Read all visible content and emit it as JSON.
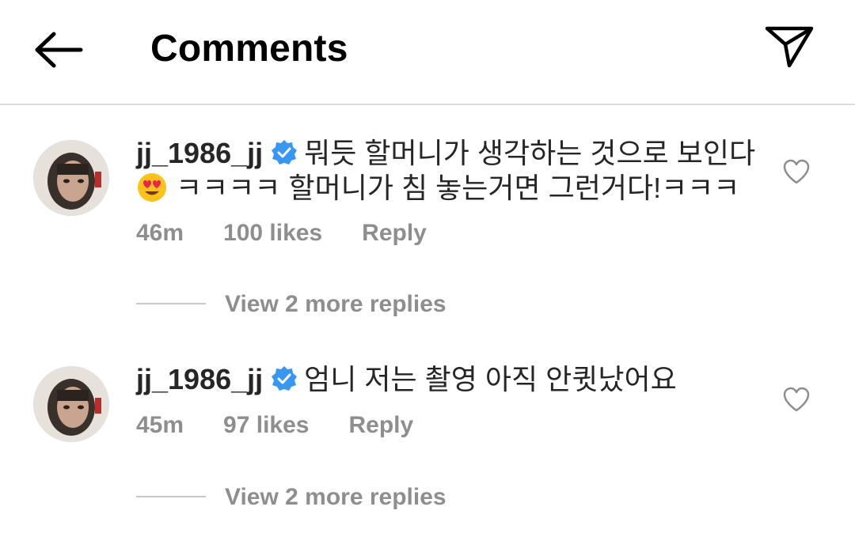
{
  "header": {
    "title": "Comments",
    "back_icon": "arrow-left-icon",
    "send_icon": "paper-plane-icon"
  },
  "colors": {
    "text": "#262626",
    "meta": "#8e8e8e",
    "verified": "#3897f0",
    "divider": "#dbdbdb"
  },
  "comments": [
    {
      "username": "jj_1986_jj",
      "verified": true,
      "text_line1": "뭐듯 할머니가 생각하는 것으로 보인다",
      "text_line2": "ㅋㅋㅋㅋ 할머니가 침 놓는거면 그런거다!ㅋㅋㅋ",
      "emoji": "heart-eyes-emoji",
      "time": "46m",
      "likes": "100 likes",
      "reply": "Reply",
      "view_replies": "View 2 more replies"
    },
    {
      "username": "jj_1986_jj",
      "verified": true,
      "text_line1": "엄니 저는 촬영 아직 안큇났어요",
      "time": "45m",
      "likes": "97 likes",
      "reply": "Reply",
      "view_replies": "View 2 more replies"
    }
  ]
}
